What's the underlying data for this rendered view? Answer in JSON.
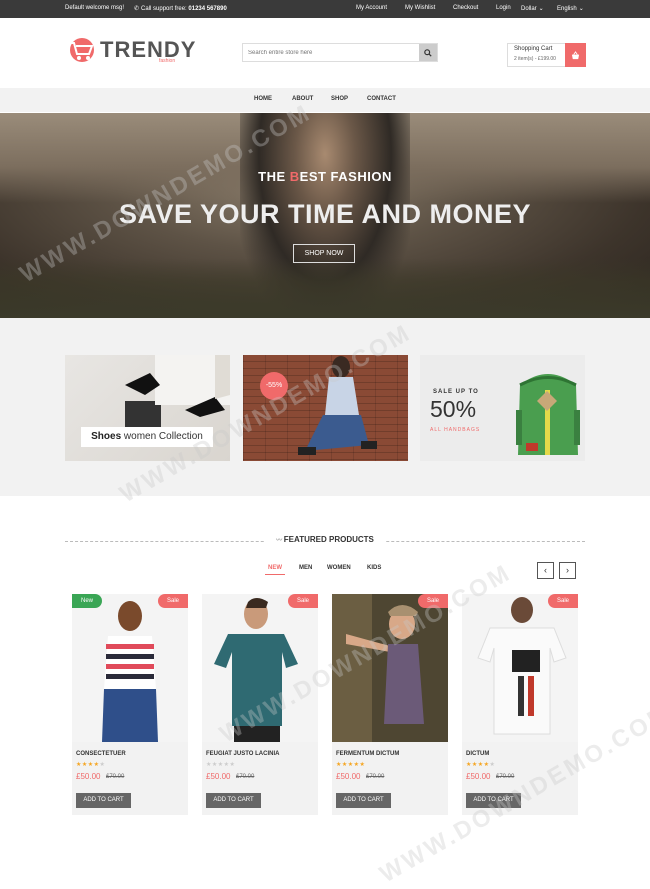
{
  "topbar": {
    "welcome": "Default welcome msg!",
    "support_label": "Call support free:",
    "support_phone": "01234 567890",
    "links": [
      "My Account",
      "My Wishlist",
      "Checkout",
      "Login"
    ],
    "currency": "Dollar",
    "language": "English"
  },
  "header": {
    "logo_text": "TRENDY",
    "logo_sub": "fashion",
    "search_placeholder": "Search entire store here",
    "cart_title": "Shopping Cart",
    "cart_summary": "2 item(s) - £199.00"
  },
  "nav": {
    "items": [
      "HOME",
      "ABOUT",
      "SHOP",
      "CONTACT"
    ]
  },
  "hero": {
    "kicker_pre": "THE ",
    "kicker_accent": "B",
    "kicker_post": "EST FASHION",
    "headline": "SAVE YOUR TIME AND MONEY",
    "button": "SHOP NOW"
  },
  "banners": {
    "shoes_strong": "Shoes",
    "shoes_rest": " women Collection",
    "discount_badge": "-55%",
    "sale_label": "SALE UP TO",
    "sale_percent": "50%",
    "sale_sub": "ALL HANDBAGS"
  },
  "featured": {
    "title": "FEATURED PRODUCTS",
    "tabs": [
      "NEW",
      "MEN",
      "WOMEN",
      "KIDS"
    ],
    "prev": "‹",
    "next": "›",
    "add_to_cart": "ADD TO CART",
    "products": [
      {
        "name": "CONSECTETUER",
        "price": "£50.00",
        "old_price": "£70.00",
        "rating": 4,
        "badges": [
          "New",
          "Sale"
        ]
      },
      {
        "name": "FEUGIAT JUSTO LACINIA",
        "price": "£50.00",
        "old_price": "£70.00",
        "rating": 0,
        "badges": [
          "Sale"
        ]
      },
      {
        "name": "FERMENTUM DICTUM",
        "price": "£50.00",
        "old_price": "£70.00",
        "rating": 5,
        "badges": [
          "Sale"
        ]
      },
      {
        "name": "DICTUM",
        "price": "£50.00",
        "old_price": "£70.00",
        "rating": 4,
        "badges": [
          "Sale"
        ]
      }
    ]
  },
  "watermark": "WWW.DOWNDEMO.COM",
  "colors": {
    "accent": "#f06a6a",
    "new_badge": "#3aa655",
    "topbar": "#3a3a3a",
    "star": "#f5a623"
  }
}
